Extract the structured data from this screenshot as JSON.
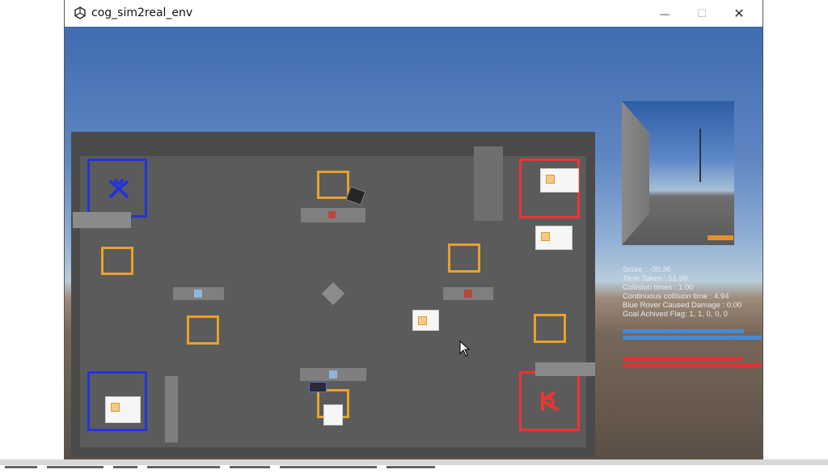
{
  "window": {
    "title": "cog_sim2real_env",
    "icon": "unity-logo-icon",
    "minimize_glyph": "—",
    "maximize_glyph": "☐",
    "close_glyph": "✕"
  },
  "hud": {
    "score": "Score : -30.36",
    "time_taken": "Time Taken : 51.98",
    "collision_times": "Collision times : 1.00",
    "continuous_collision": "Continuous collision time : 4.94",
    "blue_damage": "Blue Rover Caused Damage : 0.00",
    "goal_flag": "Goal Achived Flag: 1, 1, 0, 0, 0"
  },
  "colors": {
    "blue_zone": "#2233dd",
    "red_zone": "#ee3333",
    "target": "#e9a12b",
    "hud_blue": "#3d8ff0",
    "hud_red": "#e63030"
  },
  "scene": {
    "blue_zone_icon": "blue-robot-logo-icon",
    "red_zone_icon": "red-robot-logo-icon"
  }
}
